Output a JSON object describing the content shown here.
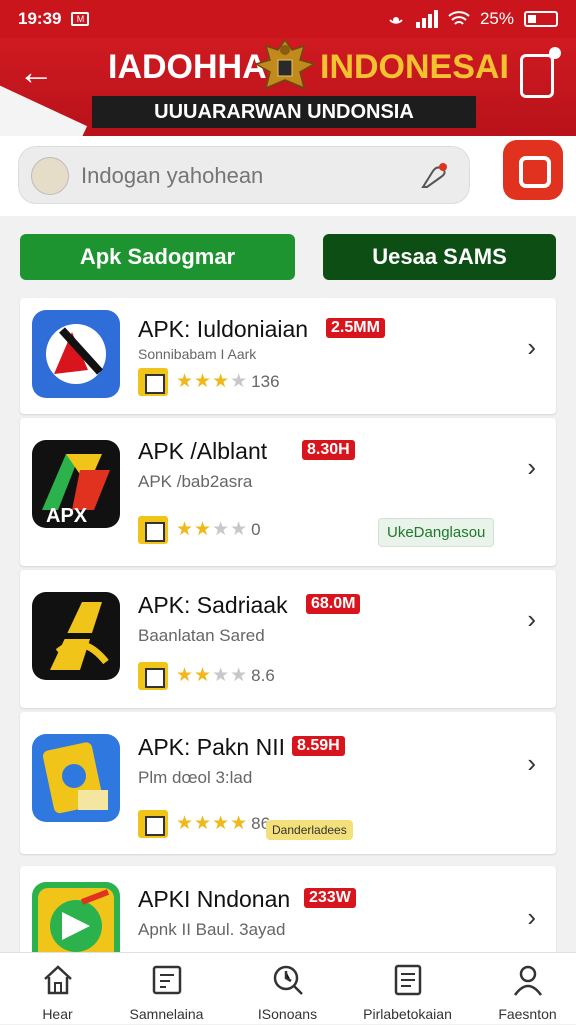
{
  "status": {
    "time": "19:39",
    "notif": "M",
    "battery": "25%"
  },
  "header": {
    "title_left": "IADOHHAN",
    "title_right": "INDONESAI",
    "subtitle": "UUUARARWAN UNDONSIA"
  },
  "search": {
    "placeholder": "Indogan yahohean"
  },
  "tabs": [
    {
      "label": "Apk Sadogmar"
    },
    {
      "label": "Uesaa SAMS"
    }
  ],
  "apps": [
    {
      "name": "APK: Iuldoniaian",
      "size": "2.5MM",
      "sub": "Sonnibabam I Aark",
      "rating": "136",
      "stars": 3
    },
    {
      "name": "APK /Alblant",
      "size": "8.30H",
      "sub": "APK /bab2asra",
      "rating": "0",
      "stars": 3,
      "tag": "UkeDanglasou"
    },
    {
      "name": "APK: Sadriaak",
      "size": "68.0M",
      "sub": "Baanlatan Sared",
      "rating": "8.6",
      "stars": 2
    },
    {
      "name": "APK: Pakn NII",
      "size": "8.59H",
      "sub": "Plm dœol 3:lad",
      "rating": "86",
      "stars": 4,
      "tag": "Danderladees"
    },
    {
      "name": "APKI Nndonan",
      "size": "233W",
      "sub": "Apnk II Baul. 3ayad"
    }
  ],
  "nav": [
    {
      "label": "Hear",
      "icon": "home-icon"
    },
    {
      "label": "Samnelaina",
      "icon": "calendar-icon"
    },
    {
      "label": "ISonoans",
      "icon": "search-icon"
    },
    {
      "label": "Pirlabetokaian",
      "icon": "list-icon"
    },
    {
      "label": "Faesnton",
      "icon": "profile-icon"
    }
  ],
  "colors": {
    "header_red": "#c9151b",
    "accent_green": "#1d9430",
    "dark_green": "#0d4e14",
    "size_red": "#d8141c",
    "star": "#f0b81c"
  }
}
